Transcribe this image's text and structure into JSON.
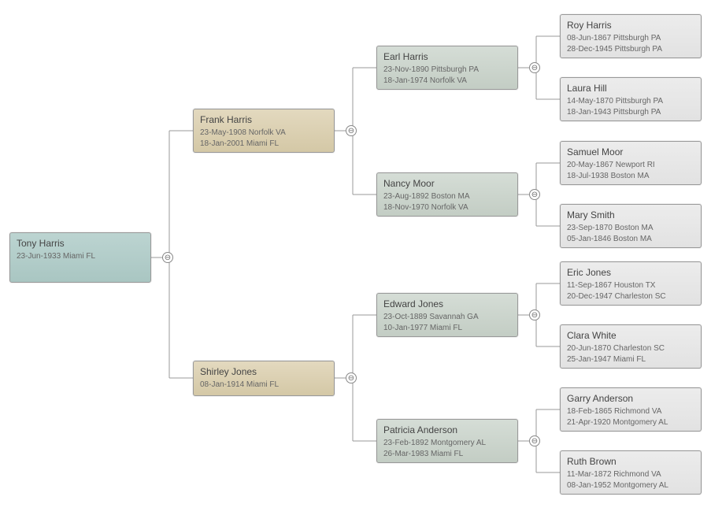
{
  "root": {
    "name": "Tony Harris",
    "birth": "23-Jun-1933 Miami FL"
  },
  "father": {
    "name": "Frank Harris",
    "birth": "23-May-1908 Norfolk VA",
    "death": "18-Jan-2001 Miami FL"
  },
  "mother": {
    "name": "Shirley Jones",
    "birth": "08-Jan-1914 Miami FL"
  },
  "pgf": {
    "name": "Earl Harris",
    "birth": "23-Nov-1890 Pittsburgh PA",
    "death": "18-Jan-1974 Norfolk VA"
  },
  "pgm": {
    "name": "Nancy Moor",
    "birth": "23-Aug-1892 Boston MA",
    "death": "18-Nov-1970 Norfolk VA"
  },
  "mgf": {
    "name": "Edward Jones",
    "birth": "23-Oct-1889 Savannah GA",
    "death": "10-Jan-1977 Miami FL"
  },
  "mgm": {
    "name": "Patricia Anderson",
    "birth": "23-Feb-1892 Montgomery AL",
    "death": "26-Mar-1983 Miami FL"
  },
  "pggf1": {
    "name": "Roy Harris",
    "birth": "08-Jun-1867 Pittsburgh PA",
    "death": "28-Dec-1945 Pittsburgh PA"
  },
  "pggm1": {
    "name": "Laura Hill",
    "birth": "14-May-1870 Pittsburgh PA",
    "death": "18-Jan-1943 Pittsburgh PA"
  },
  "pggf2": {
    "name": "Samuel Moor",
    "birth": "20-May-1867 Newport RI",
    "death": "18-Jul-1938 Boston MA"
  },
  "pggm2": {
    "name": "Mary Smith",
    "birth": "23-Sep-1870 Boston MA",
    "death": "05-Jan-1846 Boston MA"
  },
  "mggf1": {
    "name": "Eric Jones",
    "birth": "11-Sep-1867  Houston TX",
    "death": "20-Dec-1947 Charleston SC"
  },
  "mggm1": {
    "name": "Clara White",
    "birth": "20-Jun-1870 Charleston SC",
    "death": "25-Jan-1947 Miami FL"
  },
  "mggf2": {
    "name": "Garry Anderson",
    "birth": "18-Feb-1865 Richmond VA",
    "death": "21-Apr-1920 Montgomery AL"
  },
  "mggm2": {
    "name": "Ruth Brown",
    "birth": "11-Mar-1872 Richmond VA",
    "death": "08-Jan-1952 Montgomery AL"
  },
  "toggle_glyph": "⊖"
}
